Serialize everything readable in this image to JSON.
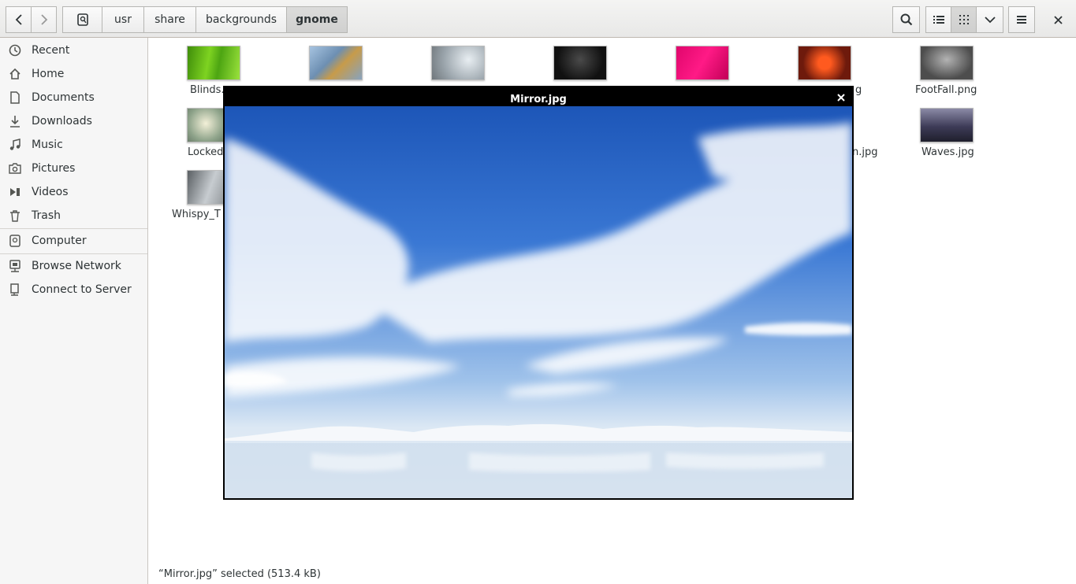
{
  "breadcrumb": [
    "usr",
    "share",
    "backgrounds",
    "gnome"
  ],
  "sidebar": {
    "places": [
      {
        "label": "Recent",
        "icon": "clock-icon"
      },
      {
        "label": "Home",
        "icon": "home-icon"
      },
      {
        "label": "Documents",
        "icon": "document-icon"
      },
      {
        "label": "Downloads",
        "icon": "download-icon"
      },
      {
        "label": "Music",
        "icon": "music-icon"
      },
      {
        "label": "Pictures",
        "icon": "camera-icon"
      },
      {
        "label": "Videos",
        "icon": "video-icon"
      },
      {
        "label": "Trash",
        "icon": "trash-icon"
      }
    ],
    "devices": [
      {
        "label": "Computer",
        "icon": "computer-icon"
      }
    ],
    "network": [
      {
        "label": "Browse Network",
        "icon": "network-icon"
      },
      {
        "label": "Connect to Server",
        "icon": "server-icon"
      }
    ]
  },
  "files": {
    "blinds": "Blinds.",
    "suffix_row1": "g",
    "footfall": "FootFall.png",
    "locked": "Locked",
    "suffix_row2": "n.jpg",
    "waves": "Waves.jpg",
    "whispy": "Whispy_T"
  },
  "preview": {
    "title": "Mirror.jpg"
  },
  "status": "“Mirror.jpg” selected  (513.4 kB)",
  "colors": {
    "accent": "#4a90d9",
    "sky": "#2a63c6"
  }
}
